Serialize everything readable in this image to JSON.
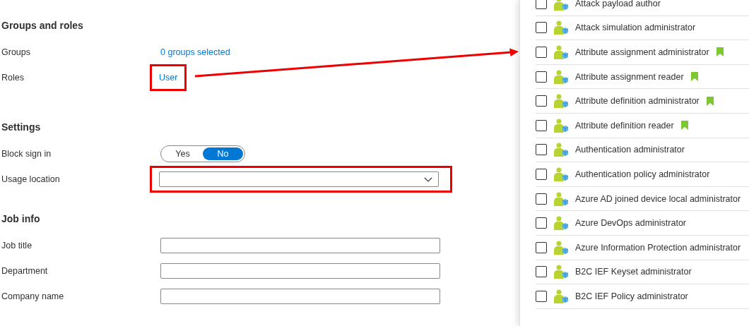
{
  "sections": [
    {
      "title": "Groups and roles",
      "fields": [
        {
          "label": "Groups",
          "kind": "link",
          "value": "0 groups selected",
          "highlighted": false
        },
        {
          "label": "Roles",
          "kind": "link",
          "value": "User",
          "highlighted": true
        }
      ]
    },
    {
      "title": "Settings",
      "fields": [
        {
          "label": "Block sign in",
          "kind": "toggle",
          "options": [
            {
              "label": "Yes",
              "selected": false
            },
            {
              "label": "No",
              "selected": true
            }
          ]
        },
        {
          "label": "Usage location",
          "kind": "dropdown",
          "highlighted": true
        }
      ]
    },
    {
      "title": "Job info",
      "fields": [
        {
          "label": "Job title",
          "kind": "text"
        },
        {
          "label": "Department",
          "kind": "text"
        },
        {
          "label": "Company name",
          "kind": "text"
        }
      ]
    }
  ],
  "roles": [
    {
      "name": "Attack payload author",
      "checked": false,
      "badge": false
    },
    {
      "name": "Attack simulation administrator",
      "checked": false,
      "badge": false
    },
    {
      "name": "Attribute assignment administrator",
      "checked": false,
      "badge": true
    },
    {
      "name": "Attribute assignment reader",
      "checked": false,
      "badge": true
    },
    {
      "name": "Attribute definition administrator",
      "checked": false,
      "badge": true
    },
    {
      "name": "Attribute definition reader",
      "checked": false,
      "badge": true
    },
    {
      "name": "Authentication administrator",
      "checked": false,
      "badge": false
    },
    {
      "name": "Authentication policy administrator",
      "checked": false,
      "badge": false
    },
    {
      "name": "Azure AD joined device local administrator",
      "checked": false,
      "badge": false
    },
    {
      "name": "Azure DevOps administrator",
      "checked": false,
      "badge": false
    },
    {
      "name": "Azure Information Protection administrator",
      "checked": false,
      "badge": false
    },
    {
      "name": "B2C IEF Keyset administrator",
      "checked": false,
      "badge": false
    },
    {
      "name": "B2C IEF Policy administrator",
      "checked": false,
      "badge": false
    }
  ]
}
